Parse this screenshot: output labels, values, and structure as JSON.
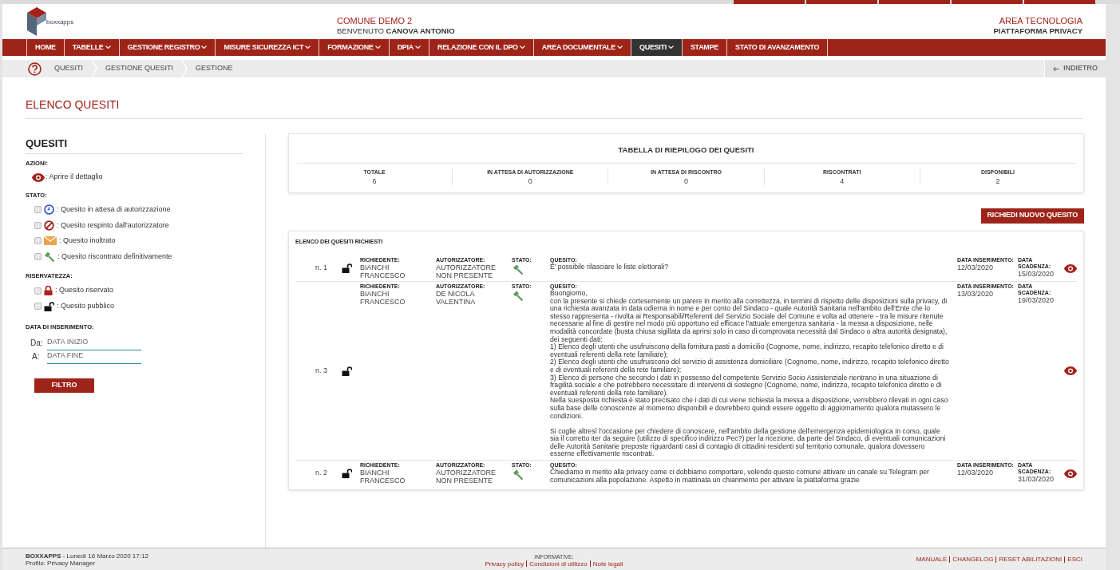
{
  "header": {
    "logo_text": "boxxapps",
    "organization": "COMUNE DEMO 2",
    "welcome": "BENVENUTO",
    "user": "CANOVA ANTONIO",
    "area": "AREA TECNOLOGIA",
    "platform": "PIATTAFORMA PRIVACY"
  },
  "nav": [
    {
      "label": "HOME",
      "dropdown": false,
      "selected": false
    },
    {
      "label": "TABELLE",
      "dropdown": true,
      "selected": false
    },
    {
      "label": "GESTIONE REGISTRO",
      "dropdown": true,
      "selected": false
    },
    {
      "label": "MISURE SICUREZZA ICT",
      "dropdown": true,
      "selected": false
    },
    {
      "label": "FORMAZIONE",
      "dropdown": true,
      "selected": false
    },
    {
      "label": "DPIA",
      "dropdown": true,
      "selected": false
    },
    {
      "label": "RELAZIONE CON IL DPO",
      "dropdown": true,
      "selected": false
    },
    {
      "label": "AREA DOCUMENTALE",
      "dropdown": true,
      "selected": false
    },
    {
      "label": "QUESITI",
      "dropdown": true,
      "selected": true
    },
    {
      "label": "STAMPE",
      "dropdown": false,
      "selected": false
    },
    {
      "label": "STATO DI AVANZAMENTO",
      "dropdown": false,
      "selected": false
    }
  ],
  "breadcrumb": [
    "QUESITI",
    "GESTIONE QUESITI",
    "GESTIONE"
  ],
  "back": "INDIETRO",
  "page_title": "ELENCO QUESITI",
  "sidebar": {
    "title": "QUESITI",
    "actions_label": "AZIONI:",
    "actions": [
      {
        "kind": "view",
        "label": ": Aprire il dettaglio"
      }
    ],
    "state_label": "STATO:",
    "states": [
      {
        "kind": "pending",
        "label": ": Quesito in attesa di autorizzazione",
        "checked": false
      },
      {
        "kind": "rejected",
        "label": ": Quesito respinto dall'autorizzatore",
        "checked": false
      },
      {
        "kind": "forwarded",
        "label": ": Quesito inoltrato",
        "checked": false
      },
      {
        "kind": "answered",
        "label": ": Quesito riscontrato definitivamente",
        "checked": false
      }
    ],
    "privacy_label": "RISERVATEZZA:",
    "privacy": [
      {
        "kind": "private",
        "label": ": Quesito riservato",
        "checked": false
      },
      {
        "kind": "public",
        "label": ": Quesito pubblico",
        "checked": false
      }
    ],
    "date_label": "DATA DI INSERIMENTO:",
    "dates": [
      {
        "label": "Da:",
        "placeholder": "DATA INIZIO"
      },
      {
        "label": "A:",
        "placeholder": "DATA FINE"
      }
    ],
    "filter_button": "FILTRO"
  },
  "summary": {
    "title": "TABELLA DI RIEPILOGO DEI QUESITI",
    "stats": [
      {
        "label": "TOTALE",
        "value": "6"
      },
      {
        "label": "IN ATTESA DI AUTORIZZAZIONE",
        "value": "0"
      },
      {
        "label": "IN ATTESA DI RISCONTRO",
        "value": "0"
      },
      {
        "label": "RISCONTRATI",
        "value": "4"
      },
      {
        "label": "DISPONIBILI",
        "value": "2"
      }
    ]
  },
  "new_button": "RICHIEDI NUOVO QUESITO",
  "list": {
    "title": "ELENCO DEI QUESITI RICHIESTI",
    "rows": [
      {
        "number": "n. 1",
        "privacy": {
          "kind": "public"
        },
        "requester_label": "RICHIEDENTE:",
        "requester": "BIANCHI FRANCESCO",
        "authorizer_label": "AUTORIZZATORE:",
        "authorizer": "AUTORIZZATORE NON PRESENTE",
        "state_label": "STATO:",
        "state": {
          "kind": "answered"
        },
        "question_label": "QUESITO:",
        "question": "E' possibile rilasciare le liste elettorali?",
        "inserted_label": "DATA INSERIMENTO:",
        "inserted": "12/03/2020",
        "due_label": "DATA SCADENZA:",
        "due": "15/03/2020"
      },
      {
        "number": "n. 3",
        "privacy": {
          "kind": "public"
        },
        "requester_label": "RICHIEDENTE:",
        "requester": "BIANCHI FRANCESCO",
        "authorizer_label": "AUTORIZZATORE:",
        "authorizer": "DE NICOLA VALENTINA",
        "state_label": "STATO:",
        "state": {
          "kind": "answered"
        },
        "question_label": "QUESITO:",
        "question": "Buongiorno,\ncon la presente si chiede cortesemente un parere in merito alla correttezza, in termini di rispetto delle disposizioni sulla privacy, di una richiesta avanzata in data odierna in nome e per conto del Sindaco - quale Autorità Sanitaria nell'ambito dell'Ente che lo stesso rappresenta - rivolta ai Responsabili/Referenti del Servizio Sociale del Comune e volta ad ottenere - tra le misure ritenute necessarie al fine di gestire nel modo più opportuno ed efficace l'attuale emergenza sanitaria - la messa a disposizione, nelle modalità concordate (busta chiusa sigillata da aprirsi solo in caso di comprovata necessità dal Sindaco o altra autorità designata), dei seguenti dati:\n1) Elenco degli utenti che usufruiscono della fornitura pasti a domicilio (Cognome, nome, indirizzo, recapito telefonico diretto e di eventuali referenti della rete familiare);\n2) Elenco degli utenti che usufruiscono del servizio di assistenza domiciliare (Cognome, nome, indirizzo, recapito telefonico diretto e di eventuali referenti della rete familiare);\n3) Elenco di persone che secondo i dati in possesso del competente Servizio Socio Assistenziale rientrano in una situazione di fragilità sociale e che potrebbero necessitare di interventi di sostegno (Cognome, nome, indirizzo, recapito telefonico diretto e di eventuali referenti della rete familiare).\nNella suesposta richiesta è stato precisato che i dati di cui viene richiesta la messa a disposizione, verrebbero rilevati in ogni caso sulla base delle conoscenze al momento disponibili e dovrebbero quindi essere oggetto di aggiornamento qualora mutassero le condizioni.\n\nSi coglie altresì l'occasione per chiedere di conoscere, nell'ambito della gestione dell'emergenza epidemiologica in corso, quale sia il corretto iter da seguire (utilizzo di specifico indirizzo Pec?) per la ricezione, da parte del Sindaco, di eventuali comunicazioni delle Autorità Sanitarie preposte riguardanti casi di contagio di cittadini residenti sul territorio comunale, qualora dovessero esserne effettivamente riscontrati.",
        "inserted_label": "DATA INSERIMENTO:",
        "inserted": "13/03/2020",
        "due_label": "DATA SCADENZA:",
        "due": "19/03/2020"
      },
      {
        "number": "n. 2",
        "privacy": {
          "kind": "public"
        },
        "requester_label": "RICHIEDENTE:",
        "requester": "BIANCHI FRANCESCO",
        "authorizer_label": "AUTORIZZATORE:",
        "authorizer": "AUTORIZZATORE NON PRESENTE",
        "state_label": "STATO:",
        "state": {
          "kind": "answered"
        },
        "question_label": "QUESITO:",
        "question": "Chiediamo in merito alla privacy come ci dobbiamo comportare, volendo questo comune attivare un canale su Telegram per comunicazioni alla popolazione. Aspetto in mattinata un chiarimento per attivare la piattaforma grazie",
        "inserted_label": "DATA INSERIMENTO:",
        "inserted": "12/03/2020",
        "due_label": "DATA SCADENZA:",
        "due": "31/03/2020"
      }
    ]
  },
  "footer": {
    "brand": "BOXXAPPS",
    "date": "- Lunedì 16 Marzo 2020 17:12",
    "profile": "Profilo: Privacy Manager",
    "info_label": "INFORMATIVE:",
    "info_links": [
      "Privacy policy",
      "Condizioni di utilizzo",
      "Note legali"
    ],
    "links": [
      "MANUALE",
      "CHANGELOG",
      "RESET ABILITAZIONI",
      "ESCI"
    ]
  }
}
